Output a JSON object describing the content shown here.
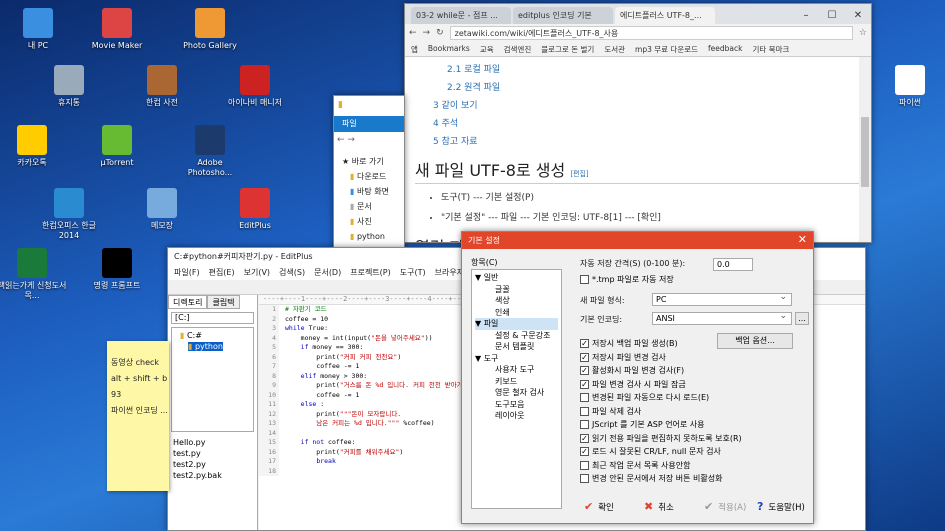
{
  "desktop": {
    "icons": [
      {
        "label": "내 PC",
        "icon": "pc-icon",
        "color": "#3b8fe0"
      },
      {
        "label": "Movie Maker",
        "icon": "movie-maker-icon",
        "color": "#d44"
      },
      {
        "label": "Photo Gallery",
        "icon": "photo-gallery-icon",
        "color": "#e93"
      },
      {
        "label": "휴지통",
        "icon": "recycle-bin-icon",
        "color": "#9ab"
      },
      {
        "label": "한컴 사전",
        "icon": "dictionary-icon",
        "color": "#a63"
      },
      {
        "label": "아이나비 매니저",
        "icon": "inavi-icon",
        "color": "#c22"
      },
      {
        "label": "카카오톡",
        "icon": "kakaotalk-icon",
        "color": "#fc0"
      },
      {
        "label": "µTorrent",
        "icon": "utorrent-icon",
        "color": "#6b3"
      },
      {
        "label": "Adobe Photosho...",
        "icon": "photoshop-icon",
        "color": "#1c3a6b"
      },
      {
        "label": "한컴오피스 한글 2014",
        "icon": "hwp-icon",
        "color": "#2a8bd0"
      },
      {
        "label": "메모장",
        "icon": "notepad-icon",
        "color": "#7ad"
      },
      {
        "label": "EditPlus",
        "icon": "editplus-icon",
        "color": "#d33"
      },
      {
        "label": "책읽는가게 신청도서목...",
        "icon": "excel-icon",
        "color": "#1a7a3a"
      },
      {
        "label": "명령 프롬프트",
        "icon": "cmd-icon",
        "color": "#000"
      },
      {
        "label": "파이썬",
        "icon": "pdf-file-icon",
        "color": "#fff"
      }
    ]
  },
  "chrome": {
    "tabs": [
      "03-2 while문 - 점프 ...",
      "editplus 인코딩 기본",
      "에디트플러스 UTF-8_..."
    ],
    "url": "zetawiki.com/wiki/에디트플러스_UTF-8_사용",
    "bookmarks": [
      "앱",
      "Bookmarks",
      "교육",
      "검색엔진",
      "블로그로 돈 벌기",
      "도서관",
      "mp3 무료 다운로드",
      "feedback",
      "기타 북마크"
    ],
    "toc": [
      "2.1 로컬 파일",
      "2.2 원격 파일",
      "3 같이 보기",
      "4 주석",
      "5 참고 자료"
    ],
    "heading": "새 파일 UTF-8로 생성",
    "edit": "[편집]",
    "bullets": [
      "도구(T) --- 기본 설정(P)",
      "\"기본 설정\" --- 파일 --- 기본 인코딩: UTF-8[1] --- [확인]"
    ],
    "heading2": "열린 파"
  },
  "explorer": {
    "ribbon": "파일",
    "items": [
      "바로 가기",
      "다운로드",
      "바탕 화면",
      "문서",
      "사진",
      "python"
    ]
  },
  "editplus": {
    "title": "C:#python#커피자판기.py - EditPlus",
    "menu": [
      "파일(F)",
      "편집(E)",
      "보기(V)",
      "검색(S)",
      "문서(D)",
      "프로젝트(P)",
      "도구(T)",
      "브라우저(B)"
    ],
    "left_tabs": [
      "디렉토리",
      "클립텍"
    ],
    "drive": "[C:]",
    "dirs": [
      "C:#",
      "python"
    ],
    "files": [
      "Hello.py",
      "test.py",
      "test2.py",
      "test2.py.bak"
    ],
    "ruler": "----+----1----+----2----+----3----+----4----+----5----+----6----+----7----+----8----+----9",
    "line_numbers": [
      "1",
      "2",
      "3",
      "4",
      "5",
      "6",
      "7",
      "8",
      "9",
      "10",
      "11",
      "12",
      "13",
      "14",
      "15",
      "16",
      "17",
      "18"
    ]
  },
  "sticky": {
    "lines": [
      "동영상 check",
      "alt + shift + b",
      "93",
      "파이썬 인코딩 ..."
    ]
  },
  "dialog": {
    "title": "기본 설정",
    "category_label": "항목(C)",
    "tree": [
      {
        "t": "▼ 일반",
        "lvl": 0
      },
      {
        "t": "글꼴",
        "lvl": 1
      },
      {
        "t": "색상",
        "lvl": 1
      },
      {
        "t": "인쇄",
        "lvl": 1
      },
      {
        "t": "▼ 파일",
        "lvl": 0,
        "sel": true
      },
      {
        "t": "설정 & 구문강조",
        "lvl": 1
      },
      {
        "t": "문서 템플릿",
        "lvl": 1
      },
      {
        "t": "▼ 도구",
        "lvl": 0
      },
      {
        "t": "사용자 도구",
        "lvl": 1
      },
      {
        "t": "키보드",
        "lvl": 1
      },
      {
        "t": "영문 철자 검사",
        "lvl": 1
      },
      {
        "t": "도구모음",
        "lvl": 1
      },
      {
        "t": "레이아웃",
        "lvl": 1
      }
    ],
    "autosave_label": "자동 저장 간격(S) (0-100 분):",
    "autosave_value": "0.0",
    "tmp_label": "*.tmp 파일로 자동 저장",
    "newfile_label": "새 파일 형식:",
    "newfile_value": "PC",
    "encoding_label": "기본 인코딩:",
    "encoding_value": "ANSI",
    "backup_button": "백업 옵션...",
    "checks": [
      {
        "t": "저장시 백업 파일 생성(B)",
        "c": true
      },
      {
        "t": "저장시 파일 변경 검사",
        "c": true
      },
      {
        "t": "활성화시 파일 변경 검사(F)",
        "c": true
      },
      {
        "t": "파일 변경 검사 시 파일 잠금",
        "c": true
      },
      {
        "t": "변경된 파일 자동으로 다시 로드(E)",
        "c": false
      },
      {
        "t": "파일 삭제 검사",
        "c": false
      },
      {
        "t": "JScript 를 기본 ASP 언어로 사용",
        "c": false
      },
      {
        "t": "읽기 전용 파일을 편집하지 못하도록 보호(R)",
        "c": true
      },
      {
        "t": "로드 시 잘못된 CR/LF, null 문자 검사",
        "c": true
      },
      {
        "t": "최근 작업 문서 목록 사용안함",
        "c": false
      },
      {
        "t": "변경 안된 문서에서 저장 버튼 비활성화",
        "c": false
      }
    ],
    "ok": "확인",
    "cancel": "취소",
    "apply": "적용(A)",
    "help": "도움말(H)"
  }
}
